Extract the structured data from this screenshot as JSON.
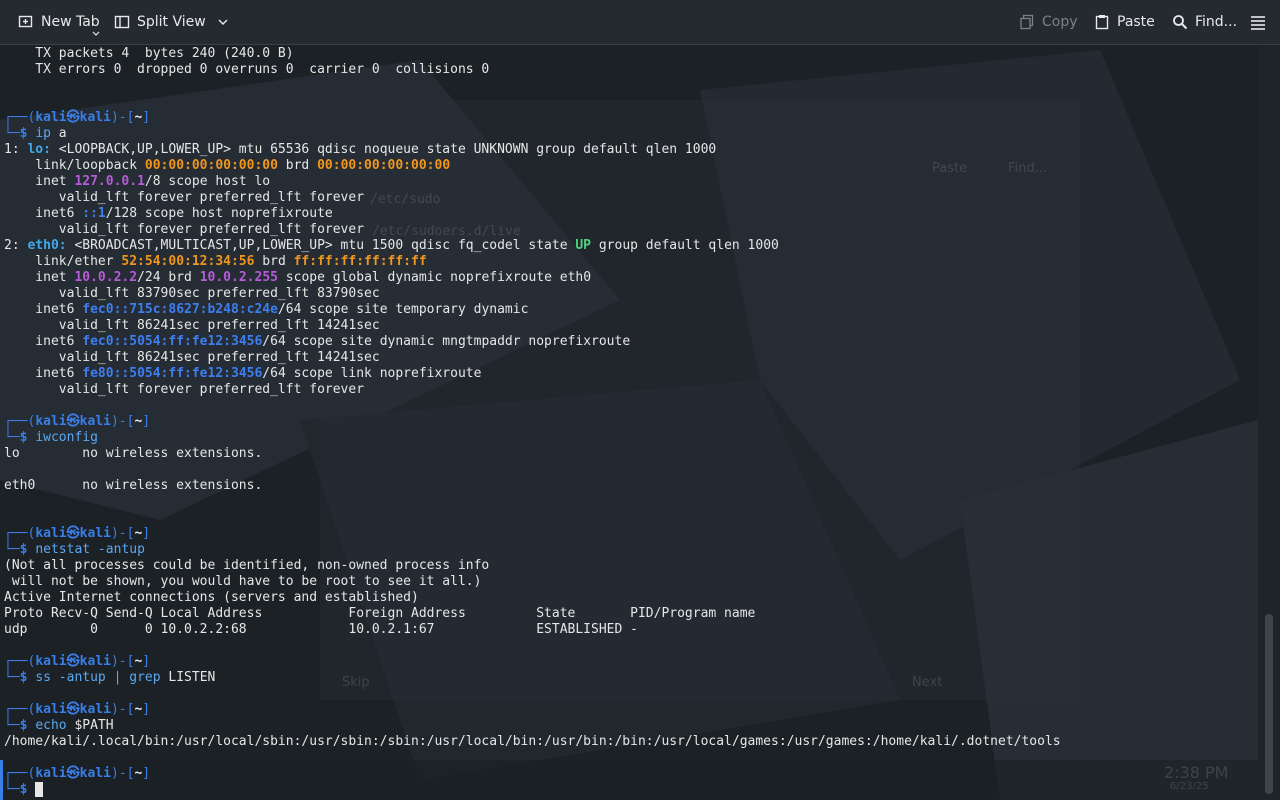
{
  "toolbar": {
    "new_tab": "New Tab",
    "split_view": "Split View",
    "copy": "Copy",
    "paste": "Paste",
    "find": "Find..."
  },
  "terminal": {
    "l1": "    TX packets 4  bytes 240 (240.0 B)",
    "l2": "    TX errors 0  dropped 0 overruns 0  carrier 0  collisions 0",
    "user": "kali",
    "host": "kali",
    "dir": "~",
    "cmd_ip": "ip",
    "arg_ip": " a",
    "lo_num": "1: ",
    "lo_name": "lo:",
    "lo_rest": " <LOOPBACK,UP,LOWER_UP> mtu 65536 qdisc noqueue state UNKNOWN group default qlen 1000",
    "lo_link_a": "    link/loopback ",
    "lo_mac": "00:00:00:00:00:00",
    "lo_brd": " brd ",
    "lo_brd_mac": "00:00:00:00:00:00",
    "lo_inet_a": "    inet ",
    "lo_inet_ip": "127.0.0.1",
    "lo_inet_b": "/8 scope host lo",
    "valid_forever": "       valid_lft forever preferred_lft forever",
    "lo_inet6_a": "    inet6 ",
    "lo_inet6_ip": "::1",
    "lo_inet6_b": "/128 scope host noprefixroute",
    "eth_num": "2: ",
    "eth_name": "eth0:",
    "eth_rest_a": " <BROADCAST,MULTICAST,UP,LOWER_UP> mtu 1500 qdisc fq_codel state ",
    "eth_up": "UP",
    "eth_rest_b": " group default qlen 1000",
    "eth_link_a": "    link/ether ",
    "eth_mac": "52:54:00:12:34:56",
    "eth_brd": " brd ",
    "eth_brd_mac": "ff:ff:ff:ff:ff:ff",
    "eth_inet_a": "    inet ",
    "eth_inet_ip": "10.0.2.2",
    "eth_inet_b": "/24 brd ",
    "eth_inet_brd": "10.0.2.255",
    "eth_inet_c": " scope global dynamic noprefixroute eth0",
    "eth_valid1": "       valid_lft 83790sec preferred_lft 83790sec",
    "eth_i6a_a": "    inet6 ",
    "eth_i6a_ip": "fec0::715c:8627:b248:c24e",
    "eth_i6a_b": "/64 scope site temporary dynamic",
    "eth_valid2": "       valid_lft 86241sec preferred_lft 14241sec",
    "eth_i6b_a": "    inet6 ",
    "eth_i6b_ip": "fec0::5054:ff:fe12:3456",
    "eth_i6b_b": "/64 scope site dynamic mngtmpaddr noprefixroute",
    "eth_valid3": "       valid_lft 86241sec preferred_lft 14241sec",
    "eth_i6c_a": "    inet6 ",
    "eth_i6c_ip": "fe80::5054:ff:fe12:3456",
    "eth_i6c_b": "/64 scope link noprefixroute",
    "eth_valid4": "       valid_lft forever preferred_lft forever",
    "cmd_iwconfig": "iwconfig",
    "iw_lo": "lo        no wireless extensions.",
    "iw_eth": "eth0      no wireless extensions.",
    "cmd_netstat": "netstat",
    "arg_netstat": " -antup",
    "ns1": "(Not all processes could be identified, non-owned process info",
    "ns2": " will not be shown, you would have to be root to see it all.)",
    "ns3": "Active Internet connections (servers and established)",
    "ns4": "Proto Recv-Q Send-Q Local Address           Foreign Address         State       PID/Program name",
    "ns5": "udp        0      0 10.0.2.2:68             10.0.2.1:67             ESTABLISHED -",
    "cmd_ss": "ss",
    "arg_ss": " -antup | ",
    "cmd_grep": "grep",
    "arg_grep": " LISTEN",
    "cmd_echo": "echo",
    "arg_echo": " $PATH",
    "path_out": "/home/kali/.local/bin:/usr/local/sbin:/usr/sbin:/sbin:/usr/local/bin:/usr/bin:/bin:/usr/local/games:/usr/games:/home/kali/.dotnet/tools"
  },
  "background": {
    "skip": "Skip",
    "next": "Next",
    "time": "2:38 PM",
    "date": "6/23/25",
    "paste": "Paste",
    "find": "Find...",
    "sudo": "/etc/sudo",
    "sudoers": "/etc/sudoers.d/live"
  },
  "colors": {
    "prompt": "#3a7ee8",
    "command": "#5aa8f0",
    "accent_purple": "#b65bd9",
    "accent_orange": "#f0961e"
  }
}
